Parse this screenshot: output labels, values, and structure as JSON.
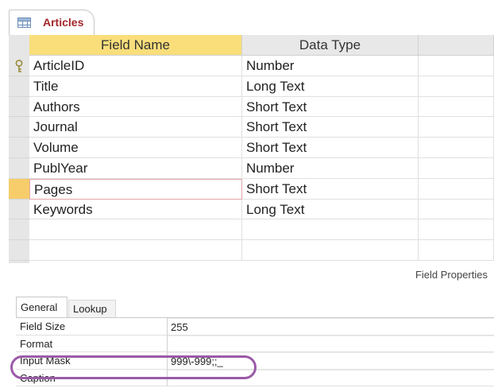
{
  "tab": {
    "title": "Articles",
    "icon": "table-icon"
  },
  "grid": {
    "headers": {
      "field_name": "Field Name",
      "data_type": "Data Type",
      "description": ""
    },
    "rows": [
      {
        "field_name": "ArticleID",
        "data_type": "Number",
        "primary_key": true
      },
      {
        "field_name": "Title",
        "data_type": "Long Text"
      },
      {
        "field_name": "Authors",
        "data_type": "Short Text"
      },
      {
        "field_name": "Journal",
        "data_type": "Short Text"
      },
      {
        "field_name": "Volume",
        "data_type": "Short Text"
      },
      {
        "field_name": "PublYear",
        "data_type": "Number"
      },
      {
        "field_name": "Pages",
        "data_type": "Short Text",
        "selected": true
      },
      {
        "field_name": "Keywords",
        "data_type": "Long Text"
      },
      {
        "field_name": "",
        "data_type": ""
      },
      {
        "field_name": "",
        "data_type": ""
      },
      {
        "field_name": "",
        "data_type": ""
      }
    ]
  },
  "field_properties": {
    "label": "Field Properties",
    "tabs": [
      {
        "label": "General",
        "active": true
      },
      {
        "label": "Lookup",
        "active": false
      }
    ],
    "properties": [
      {
        "name": "Field Size",
        "value": "255"
      },
      {
        "name": "Format",
        "value": ""
      },
      {
        "name": "Input Mask",
        "value": "999\\-999;;_",
        "highlighted": true
      },
      {
        "name": "Caption",
        "value": ""
      }
    ]
  },
  "colors": {
    "tab_title": "#a4262c",
    "header_active": "#f9de7a",
    "row_selector_active": "#f7cd6b",
    "annotation_ring": "#9b5aa8"
  }
}
